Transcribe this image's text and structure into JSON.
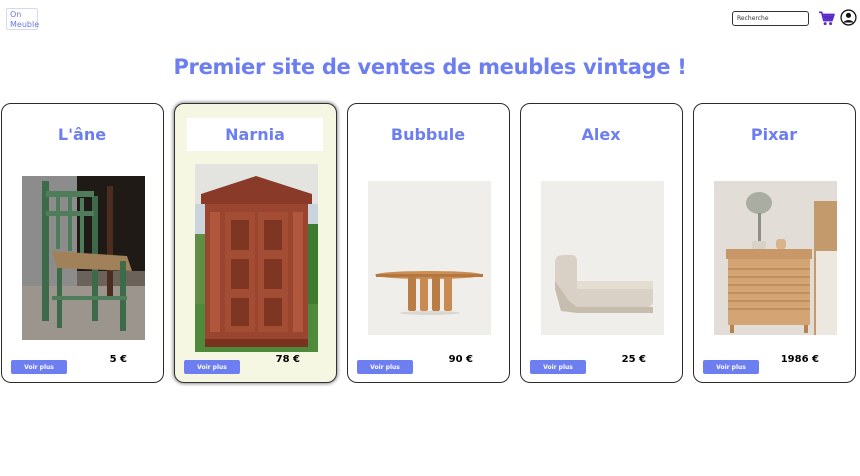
{
  "header": {
    "logo_line1": "On",
    "logo_line2": "Meuble",
    "search_placeholder": "Recherche",
    "cart_icon": "cart-icon",
    "user_icon": "user-account-icon"
  },
  "title": "Premier site de ventes de meubles vintage !",
  "products": [
    {
      "name": "L'âne",
      "price": "5 €",
      "button": "Voir plus",
      "image": "old green wooden chair"
    },
    {
      "name": "Narnia",
      "price": "78 €",
      "button": "Voir plus",
      "image": "carved wooden wardrobe"
    },
    {
      "name": "Bubbule",
      "price": "90 €",
      "button": "Voir plus",
      "image": "oval wooden table"
    },
    {
      "name": "Alex",
      "price": "25 €",
      "button": "Voir plus",
      "image": "beige chaise longue"
    },
    {
      "name": "Pixar",
      "price": "1986 €",
      "button": "Voir plus",
      "image": "wooden nightstand with lamp"
    }
  ],
  "colors": {
    "accent": "#6d7ef0",
    "highlight_card": "#f6f7e3",
    "cart": "#5b2bc7"
  }
}
